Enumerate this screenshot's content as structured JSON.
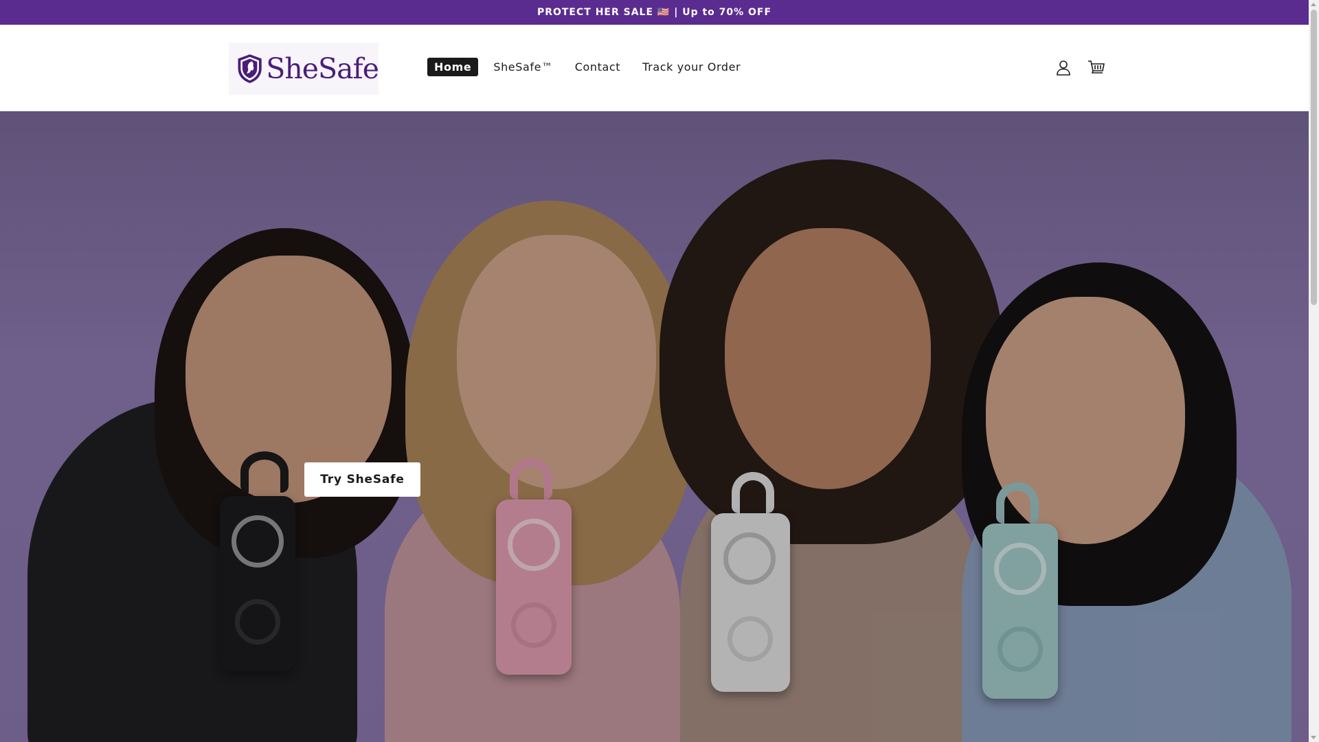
{
  "announcement": {
    "text": "PROTECT HER SALE 🇺🇸 | Up to 70% OFF"
  },
  "header": {
    "logo_text": "SheSafe",
    "nav": [
      {
        "label": "Home",
        "active": true
      },
      {
        "label": "SheSafe™",
        "active": false
      },
      {
        "label": "Contact",
        "active": false
      },
      {
        "label": "Track your Order",
        "active": false
      }
    ],
    "icons": [
      "account-icon",
      "cart-icon"
    ]
  },
  "hero": {
    "cta_label": "Try SheSafe"
  },
  "colors": {
    "brand_purple": "#5b2c8f",
    "logo_purple": "#4b1d7a",
    "active_nav_bg": "#1a1a1a"
  }
}
